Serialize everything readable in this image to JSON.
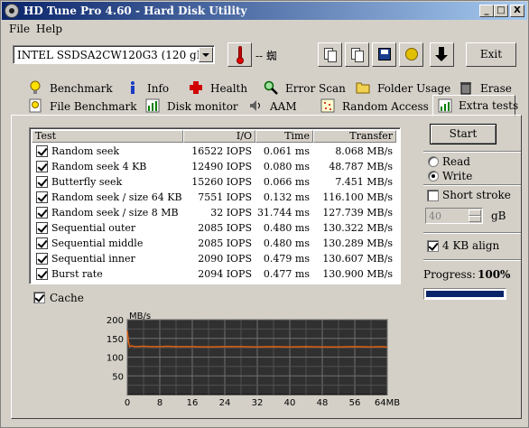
{
  "window": {
    "title": "HD Tune Pro 4.60 - Hard Disk Utility"
  },
  "titlebar_buttons": {
    "minimize": "_",
    "maximize": "□",
    "close": "X"
  },
  "menu": {
    "file": "File",
    "help": "Help"
  },
  "toolbar": {
    "drive": "INTEL SSDSA2CW120G3     (120 gB)",
    "temperature": "-- 蜘",
    "exit_label": "Exit"
  },
  "tabs_row1": [
    {
      "label": "Benchmark",
      "icon": "bulb-icon"
    },
    {
      "label": "Info",
      "icon": "info-icon"
    },
    {
      "label": "Health",
      "icon": "health-cross-icon"
    },
    {
      "label": "Error Scan",
      "icon": "magnifier-icon"
    },
    {
      "label": "Folder Usage",
      "icon": "folder-icon"
    },
    {
      "label": "Erase",
      "icon": "trash-icon"
    }
  ],
  "tabs_row2": [
    {
      "label": "File Benchmark",
      "icon": "file-bulb-icon"
    },
    {
      "label": "Disk monitor",
      "icon": "bar-chart-icon"
    },
    {
      "label": "AAM",
      "icon": "speaker-icon"
    },
    {
      "label": "Random Access",
      "icon": "dots-icon"
    },
    {
      "label": "Extra tests",
      "icon": "extra-tests-icon",
      "active": true
    }
  ],
  "table": {
    "headers": [
      "Test",
      "I/O",
      "Time",
      "Transfer"
    ],
    "rows": [
      {
        "test": "Random seek",
        "io": "16522 IOPS",
        "time": "0.061 ms",
        "transfer": "8.068 MB/s"
      },
      {
        "test": "Random seek 4 KB",
        "io": "12490 IOPS",
        "time": "0.080 ms",
        "transfer": "48.787 MB/s"
      },
      {
        "test": "Butterfly seek",
        "io": "15260 IOPS",
        "time": "0.066 ms",
        "transfer": "7.451 MB/s"
      },
      {
        "test": "Random seek / size 64 KB",
        "io": "7551 IOPS",
        "time": "0.132 ms",
        "transfer": "116.100 MB/s"
      },
      {
        "test": "Random seek / size 8 MB",
        "io": "32 IOPS",
        "time": "31.744 ms",
        "transfer": "127.739 MB/s"
      },
      {
        "test": "Sequential outer",
        "io": "2085 IOPS",
        "time": "0.480 ms",
        "transfer": "130.322 MB/s"
      },
      {
        "test": "Sequential middle",
        "io": "2085 IOPS",
        "time": "0.480 ms",
        "transfer": "130.289 MB/s"
      },
      {
        "test": "Sequential inner",
        "io": "2090 IOPS",
        "time": "0.479 ms",
        "transfer": "130.607 MB/s"
      },
      {
        "test": "Burst rate",
        "io": "2094 IOPS",
        "time": "0.477 ms",
        "transfer": "130.900 MB/s"
      }
    ]
  },
  "cache_label": "Cache",
  "controls": {
    "start_label": "Start",
    "read_label": "Read",
    "write_label": "Write",
    "mode_selected": "Write",
    "short_stroke_label": "Short stroke",
    "short_stroke_value": "40",
    "short_stroke_unit": "gB",
    "align_label": "4 KB align",
    "progress_label": "Progress:",
    "progress_value": "100%",
    "progress_fraction": 1.0
  },
  "colors": {
    "titlebar_start": "#0a246a",
    "titlebar_end": "#a6caf0",
    "chart_bg": "#303030",
    "chart_grid": "#707070",
    "chart_line": "#e06010",
    "progress": "#0a246a"
  },
  "chart_data": {
    "type": "line",
    "ylabel": "MB/s",
    "xlabel": "",
    "x_unit": "MB",
    "ylim": [
      0,
      200
    ],
    "xlim": [
      0,
      64
    ],
    "y_ticks": [
      "200",
      "150",
      "100",
      "50"
    ],
    "x_ticks": [
      "0",
      "8",
      "16",
      "24",
      "32",
      "40",
      "48",
      "56",
      "64MB"
    ],
    "grid": true,
    "series": [
      {
        "x": [
          0,
          0.3,
          0.6,
          1,
          2,
          4,
          6,
          8,
          10,
          12,
          16,
          20,
          24,
          28,
          32,
          36,
          40,
          44,
          48,
          52,
          56,
          60,
          62,
          64
        ],
        "y": [
          170,
          140,
          128,
          130,
          128,
          129,
          128,
          128,
          129,
          128,
          128,
          127,
          128,
          128,
          127,
          128,
          127,
          128,
          127,
          127,
          128,
          127,
          128,
          127
        ]
      }
    ]
  }
}
